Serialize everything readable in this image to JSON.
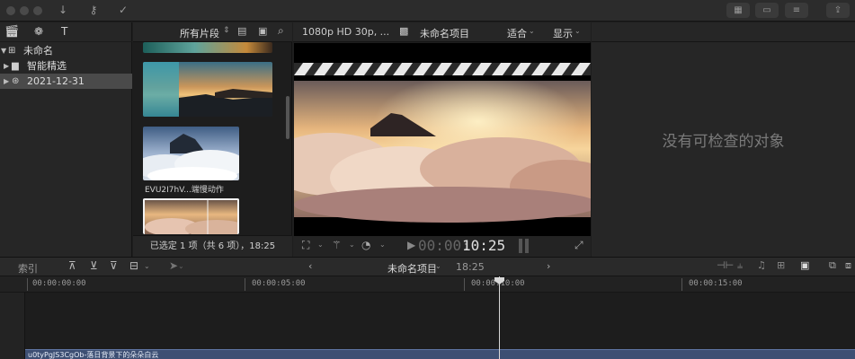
{
  "library": {
    "items": [
      {
        "label": "未命名",
        "expanded": true,
        "selected": false
      },
      {
        "label": "智能精选",
        "expanded": false,
        "selected": false
      },
      {
        "label": "2021-12-31",
        "expanded": false,
        "selected": true
      }
    ]
  },
  "browser": {
    "filter_label": "所有片段",
    "clips": [
      {
        "name": ""
      },
      {
        "name": "EVU2I7hV...端慢动作"
      },
      {
        "name": ""
      }
    ],
    "selection_status": "已选定 1 项（共 6 项），18:25"
  },
  "viewer": {
    "format_label": "1080p HD 30p, ...",
    "project_name": "未命名项目",
    "zoom_label": "适合",
    "display_label": "显示",
    "timecode_dim": "00:00:",
    "timecode_bright": "10:25"
  },
  "inspector": {
    "empty_message": "没有可检查的对象"
  },
  "timeline": {
    "index_label": "索引",
    "project_name": "未命名项目",
    "duration": "18:25",
    "ruler_labels": [
      "00:00:00:00",
      "00:00:05:00",
      "00:00:10:00",
      "00:00:15:00"
    ],
    "clip_name": "u0tyPgJS3CgOb-落日背景下的朵朵白云"
  },
  "colors": {
    "selection": "#4a4a4a",
    "clip_bar": "#3d4f73",
    "playhead": "#d8d8d8",
    "inspector_text": "#7a7a7a"
  }
}
